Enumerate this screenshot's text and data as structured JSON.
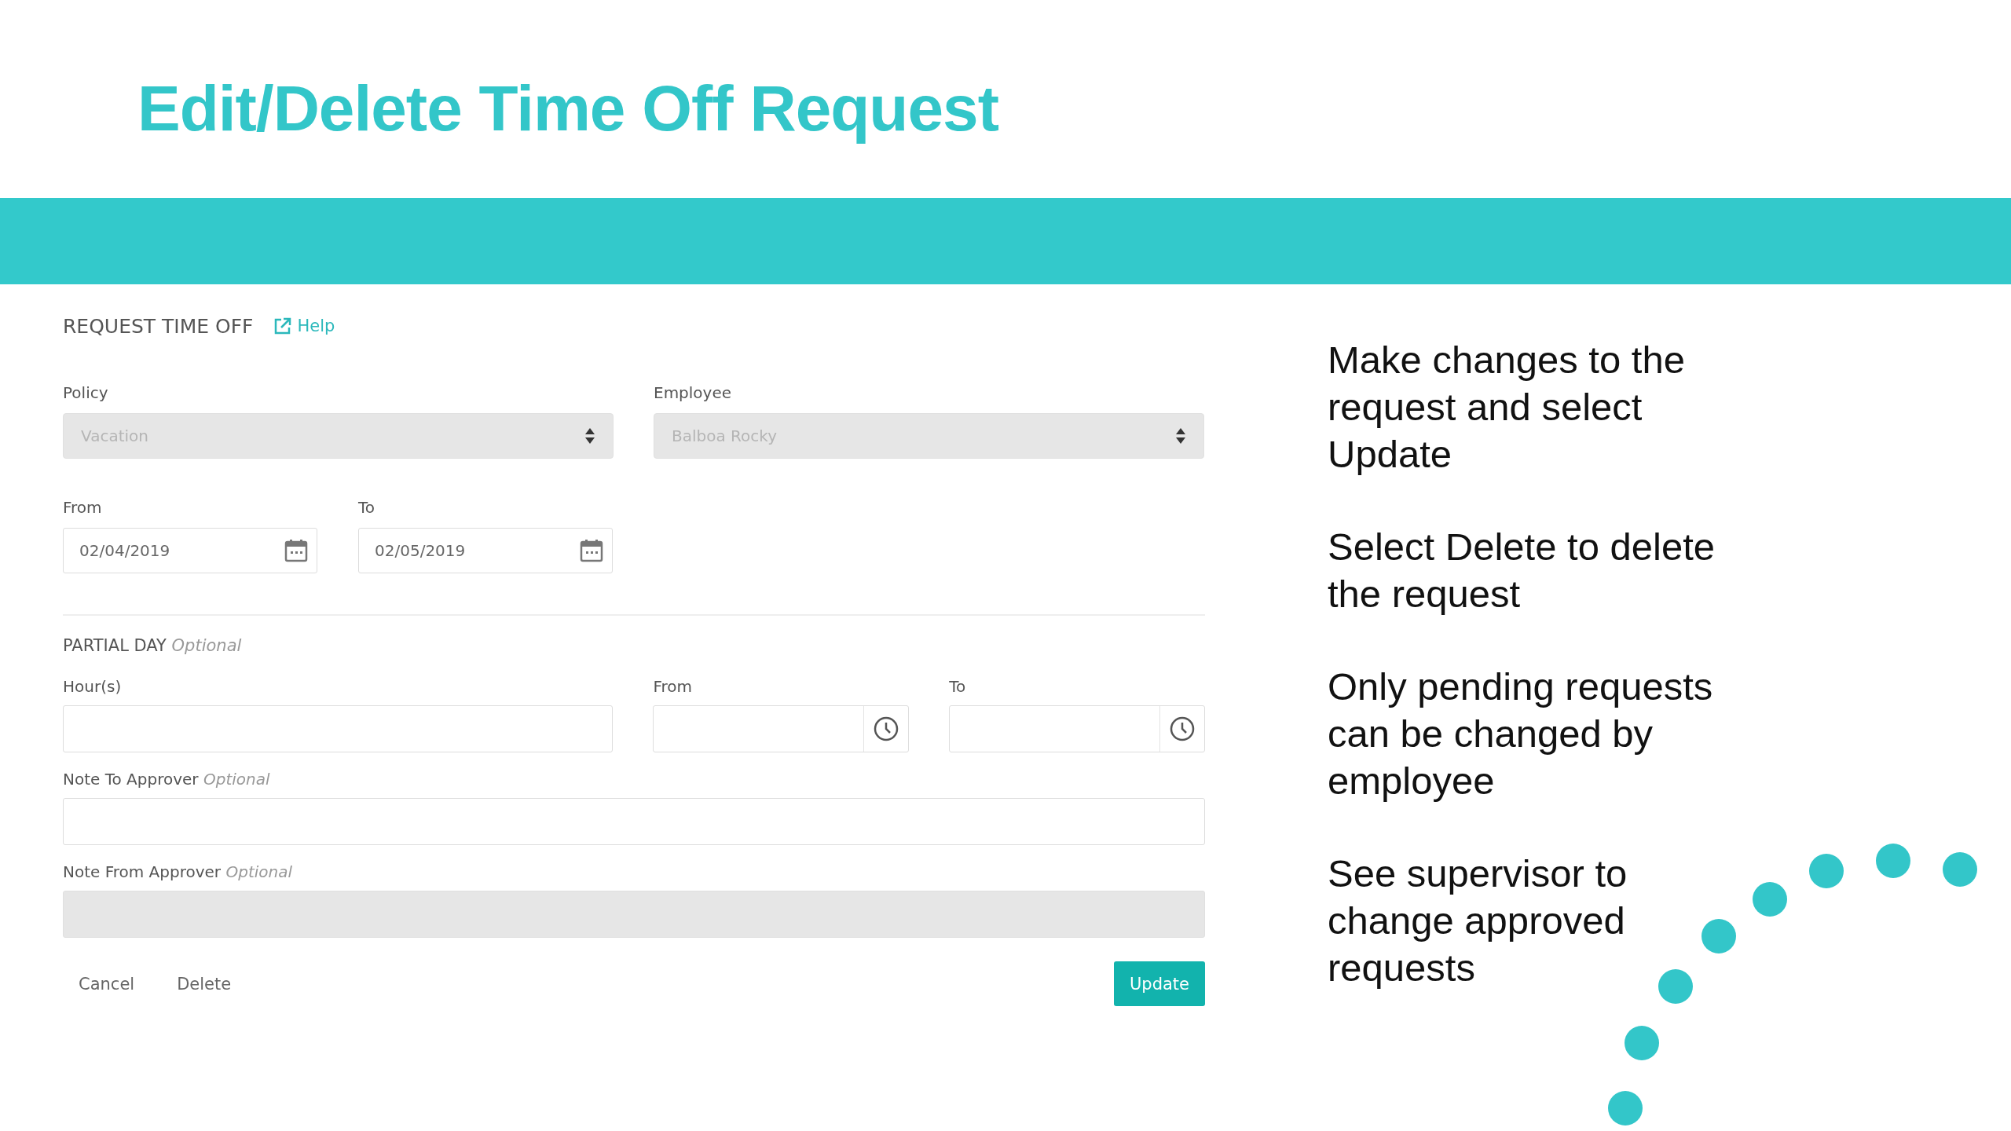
{
  "slide_title": "Edit/Delete Time Off Request",
  "form": {
    "heading": "REQUEST TIME OFF",
    "help_link": "Help",
    "selects": [
      {
        "label": "Policy",
        "value": "Vacation",
        "disabled": true
      },
      {
        "label": "Employee",
        "value": "Balboa Rocky",
        "disabled": true
      }
    ],
    "dates": [
      {
        "label": "From",
        "value": "02/04/2019"
      },
      {
        "label": "To",
        "value": "02/05/2019"
      }
    ],
    "partial_day": {
      "heading": "PARTIAL DAY",
      "optional": "Optional",
      "hours_label": "Hour(s)",
      "from_label": "From",
      "to_label": "To"
    },
    "notes": [
      {
        "label": "Note To Approver",
        "optional": "Optional",
        "disabled": false
      },
      {
        "label": "Note From Approver",
        "optional": "Optional",
        "disabled": true
      }
    ],
    "buttons": [
      {
        "label": "Cancel",
        "kind": "link"
      },
      {
        "label": "Delete",
        "kind": "link"
      },
      {
        "label": "Update",
        "kind": "primary"
      }
    ]
  },
  "instructions": [
    "Make changes to the request and select Update",
    "Select Delete to delete the request",
    "Only pending requests can be changed by employee",
    "See supervisor to change approved requests"
  ]
}
